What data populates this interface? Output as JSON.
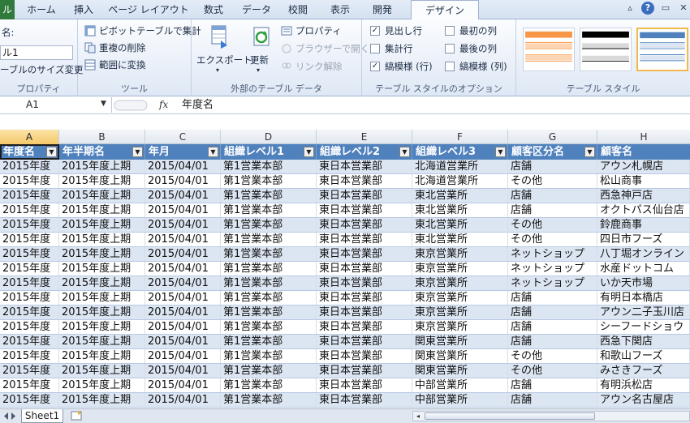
{
  "ribbon_tabs": [
    {
      "label": "ル",
      "x": 0
    },
    {
      "label": "ホーム"
    },
    {
      "label": "挿入"
    },
    {
      "label": "ページ レイアウト"
    },
    {
      "label": "数式"
    },
    {
      "label": "データ"
    },
    {
      "label": "校閲"
    },
    {
      "label": "表示"
    },
    {
      "label": "開発"
    },
    {
      "label": "デザイン"
    }
  ],
  "properties_group": {
    "table_name_label": "名:",
    "table_name_value": "ル1",
    "resize_label": "ーブルのサイズ変更",
    "group_label": "プロパティ"
  },
  "tools_group": {
    "pivot_label": "ピボットテーブルで集計",
    "remove_dup_label": "重複の削除",
    "convert_label": "範囲に変換",
    "group_label": "ツール"
  },
  "external_group": {
    "export_label": "エクスポート",
    "refresh_label": "更新",
    "properties_label": "プロパティ",
    "open_browser_label": "ブラウザーで開く",
    "unlink_label": "リンク解除",
    "group_label": "外部のテーブル データ"
  },
  "style_options_group": {
    "options": [
      {
        "label": "見出し行",
        "checked": "✓"
      },
      {
        "label": "集計行",
        "checked": ""
      },
      {
        "label": "縞模様 (行)",
        "checked": "✓"
      },
      {
        "label": "最初の列",
        "checked": ""
      },
      {
        "label": "最後の列",
        "checked": ""
      },
      {
        "label": "縞模様 (列)",
        "checked": ""
      }
    ],
    "group_label": "テーブル スタイルのオプション"
  },
  "table_styles_group": {
    "group_label": "テーブル スタイル",
    "swatch_colors": [
      "#f79646",
      "#000000",
      "#4f81bd"
    ]
  },
  "formula_bar": {
    "name_box": "A1",
    "fx": "fx",
    "content": "年度名"
  },
  "column_letters": [
    "A",
    "B",
    "C",
    "D",
    "E",
    "F",
    "G",
    "H"
  ],
  "table": {
    "headers": [
      "年度名",
      "年半期名",
      "年月",
      "組織レベル1",
      "組織レベル2",
      "組織レベル3",
      "顧客区分名",
      "顧客名"
    ],
    "rows": [
      [
        "2015年度",
        "2015年度上期",
        "2015/04/01",
        "第1営業本部",
        "東日本営業部",
        "北海道営業所",
        "店舗",
        "アウン札幌店"
      ],
      [
        "2015年度",
        "2015年度上期",
        "2015/04/01",
        "第1営業本部",
        "東日本営業部",
        "北海道営業所",
        "その他",
        "松山商事"
      ],
      [
        "2015年度",
        "2015年度上期",
        "2015/04/01",
        "第1営業本部",
        "東日本営業部",
        "東北営業所",
        "店舗",
        "西急神戸店"
      ],
      [
        "2015年度",
        "2015年度上期",
        "2015/04/01",
        "第1営業本部",
        "東日本営業部",
        "東北営業所",
        "店舗",
        "オクトパス仙台店"
      ],
      [
        "2015年度",
        "2015年度上期",
        "2015/04/01",
        "第1営業本部",
        "東日本営業部",
        "東北営業所",
        "その他",
        "鈴鹿商事"
      ],
      [
        "2015年度",
        "2015年度上期",
        "2015/04/01",
        "第1営業本部",
        "東日本営業部",
        "東北営業所",
        "その他",
        "四日市フーズ"
      ],
      [
        "2015年度",
        "2015年度上期",
        "2015/04/01",
        "第1営業本部",
        "東日本営業部",
        "東京営業所",
        "ネットショップ",
        "八丁堀オンライン"
      ],
      [
        "2015年度",
        "2015年度上期",
        "2015/04/01",
        "第1営業本部",
        "東日本営業部",
        "東京営業所",
        "ネットショップ",
        "水産ドットコム"
      ],
      [
        "2015年度",
        "2015年度上期",
        "2015/04/01",
        "第1営業本部",
        "東日本営業部",
        "東京営業所",
        "ネットショップ",
        "いか天市場"
      ],
      [
        "2015年度",
        "2015年度上期",
        "2015/04/01",
        "第1営業本部",
        "東日本営業部",
        "東京営業所",
        "店舗",
        "有明日本橋店"
      ],
      [
        "2015年度",
        "2015年度上期",
        "2015/04/01",
        "第1営業本部",
        "東日本営業部",
        "東京営業所",
        "店舗",
        "アウン二子玉川店"
      ],
      [
        "2015年度",
        "2015年度上期",
        "2015/04/01",
        "第1営業本部",
        "東日本営業部",
        "東京営業所",
        "店舗",
        "シーフードショウ"
      ],
      [
        "2015年度",
        "2015年度上期",
        "2015/04/01",
        "第1営業本部",
        "東日本営業部",
        "関東営業所",
        "店舗",
        "西急下関店"
      ],
      [
        "2015年度",
        "2015年度上期",
        "2015/04/01",
        "第1営業本部",
        "東日本営業部",
        "関東営業所",
        "その他",
        "和歌山フーズ"
      ],
      [
        "2015年度",
        "2015年度上期",
        "2015/04/01",
        "第1営業本部",
        "東日本営業部",
        "関東営業所",
        "その他",
        "みさきフーズ"
      ],
      [
        "2015年度",
        "2015年度上期",
        "2015/04/01",
        "第1営業本部",
        "東日本営業部",
        "中部営業所",
        "店舗",
        "有明浜松店"
      ],
      [
        "2015年度",
        "2015年度上期",
        "2015/04/01",
        "第1営業本部",
        "東日本営業部",
        "中部営業所",
        "店舗",
        "アウン名古屋店"
      ]
    ]
  },
  "sheet_tabs": {
    "active": "Sheet1"
  }
}
